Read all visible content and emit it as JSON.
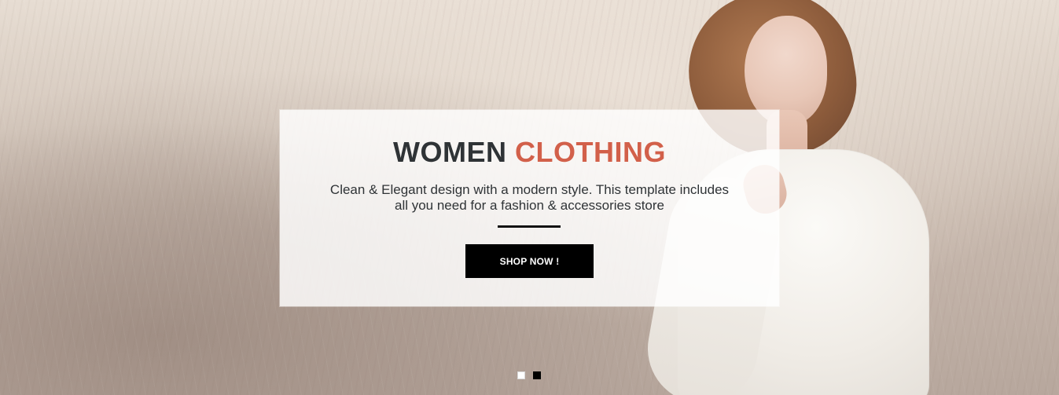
{
  "hero": {
    "headline": {
      "part1": "WOMEN",
      "part2": "CLOTHING"
    },
    "description_line1": "Clean & Elegant design with a modern style. This template includes",
    "description_line2": "all you need for a fashion & accessories store",
    "cta_label": "SHOP NOW !"
  },
  "carousel": {
    "slides_count": 2,
    "active_index": 1
  },
  "colors": {
    "headline_dark": "#2f3336",
    "headline_accent": "#d2604a",
    "cta_background": "#000000",
    "cta_text": "#ffffff"
  }
}
